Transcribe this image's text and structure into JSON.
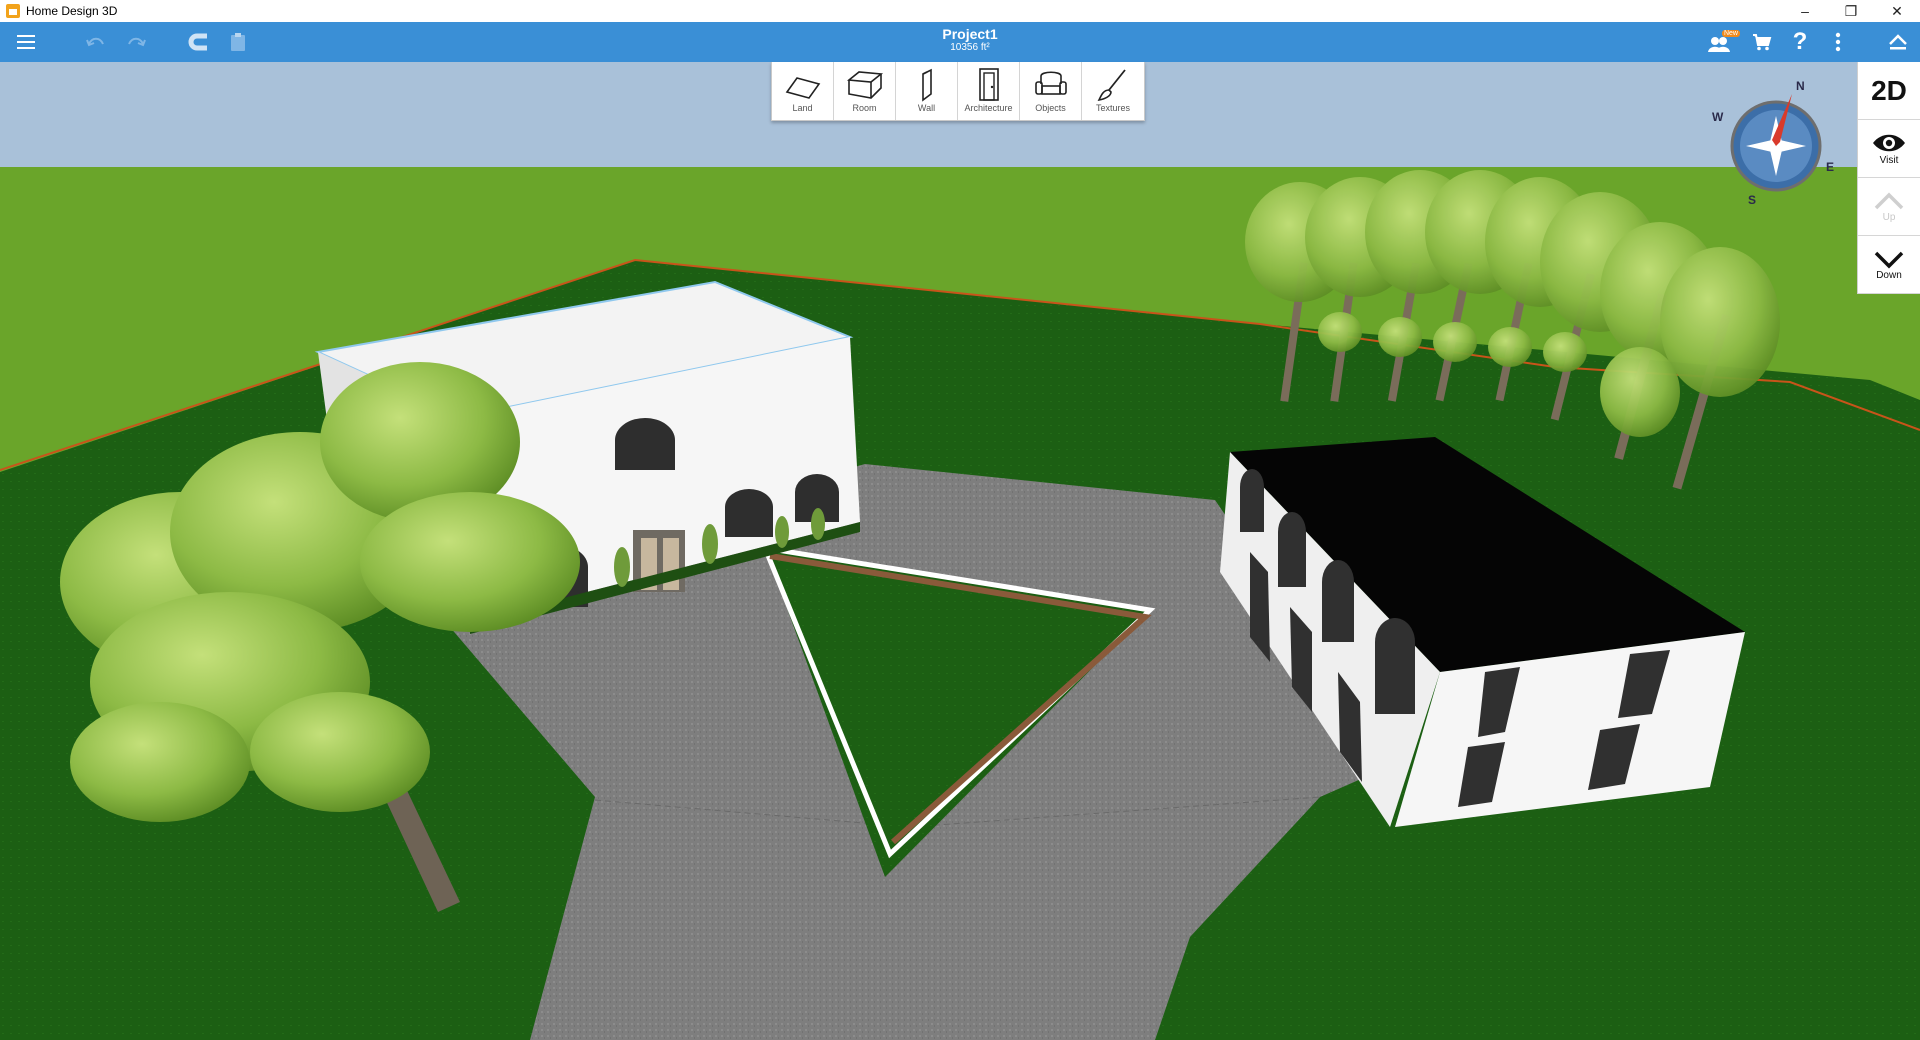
{
  "window": {
    "title": "Home Design 3D",
    "controls": {
      "minimize": "–",
      "restore": "❐",
      "close": "✕"
    }
  },
  "appbar": {
    "project_name": "Project1",
    "project_area": "10356 ft²",
    "left_icons": [
      "menu-icon",
      "undo-icon",
      "redo-icon",
      "magnet-icon",
      "paste-icon"
    ],
    "right_icons": [
      "community-new-icon",
      "cart-icon",
      "help-icon",
      "more-icon",
      "collapse-icon"
    ],
    "badge_text": "New"
  },
  "toolbar": {
    "tools": [
      {
        "label": "Land",
        "icon": "land-icon"
      },
      {
        "label": "Room",
        "icon": "room-icon"
      },
      {
        "label": "Wall",
        "icon": "wall-icon"
      },
      {
        "label": "Architecture",
        "icon": "door-icon"
      },
      {
        "label": "Objects",
        "icon": "armchair-icon"
      },
      {
        "label": "Textures",
        "icon": "brush-icon"
      }
    ]
  },
  "sidepanel": {
    "view_toggle": "2D",
    "visit_label": "Visit",
    "up_label": "Up",
    "down_label": "Down"
  },
  "compass": {
    "n": "N",
    "e": "E",
    "s": "S",
    "w": "W"
  },
  "colors": {
    "appbar": "#3a8fd6",
    "sky": "#a9c1d9",
    "grass_far": "#6aa52a",
    "grass_near": "#1b5e12",
    "pavement": "#808080"
  }
}
